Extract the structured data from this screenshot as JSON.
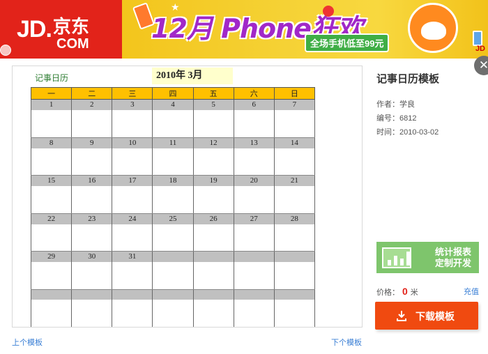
{
  "banner": {
    "logo_jd": "JD.",
    "logo_cn": "京东",
    "logo_com": "COM",
    "promo_headline": "12月 Phone狂欢",
    "promo_slogan": "全场手机低至99元",
    "promo_badge": "JD",
    "brand_color": "#e2231a",
    "promo_color": "#f5d235"
  },
  "calendar": {
    "title_left": "记事日历",
    "month_label": "2010年 3月",
    "weekdays": [
      "一",
      "二",
      "三",
      "四",
      "五",
      "六",
      "日"
    ],
    "weeks": [
      [
        "1",
        "2",
        "3",
        "4",
        "5",
        "6",
        "7"
      ],
      [
        "8",
        "9",
        "10",
        "11",
        "12",
        "13",
        "14"
      ],
      [
        "15",
        "16",
        "17",
        "18",
        "19",
        "20",
        "21"
      ],
      [
        "22",
        "23",
        "24",
        "25",
        "26",
        "27",
        "28"
      ],
      [
        "29",
        "30",
        "31",
        "",
        "",
        "",
        ""
      ],
      [
        "",
        "",
        "",
        "",
        "",
        "",
        ""
      ]
    ],
    "header_color": "#ffc000",
    "number_row_color": "#c0c0c0"
  },
  "info": {
    "title": "记事日历模板",
    "author": "作者：学良",
    "number": "编号：6812",
    "time": "时间：2010-03-02",
    "price_label": "价格：",
    "price_value": "0",
    "price_unit": "米",
    "recharge": "充值",
    "download": "下载模板",
    "close_icon": "close-icon"
  },
  "ad": {
    "line1": "统计报表",
    "line2": "定制开发",
    "icon": "bar-chart-icon",
    "color": "#7ec56c"
  },
  "nav": {
    "prev": "上个模板",
    "next": "下个模板"
  }
}
